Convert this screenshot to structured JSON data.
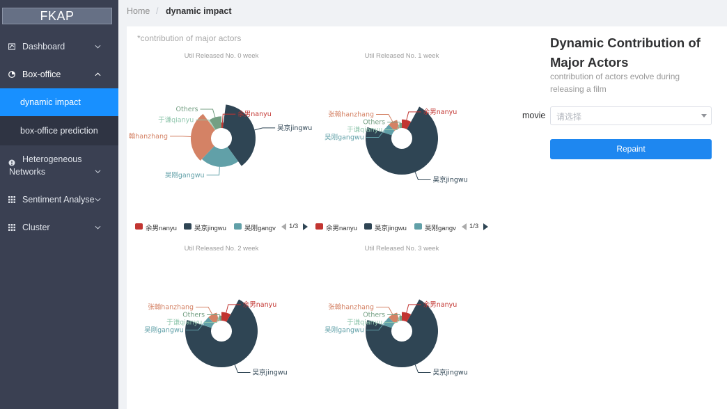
{
  "app": {
    "logo": "FKAP"
  },
  "sidebar": {
    "items": [
      {
        "label": "Dashboard",
        "icon": "dashboard-icon"
      },
      {
        "label": "Box-office",
        "icon": "pie-icon"
      },
      {
        "label": "Heterogeneous Networks",
        "label_line1": "Heterogeneous",
        "label_line2": "Networks",
        "icon": "network-icon"
      },
      {
        "label": "Sentiment Analyse",
        "icon": "grid-icon"
      },
      {
        "label": "Cluster",
        "icon": "grid-icon"
      }
    ],
    "submenu": [
      {
        "label": "dynamic impact",
        "active": true
      },
      {
        "label": "box-office prediction",
        "active": false
      }
    ]
  },
  "breadcrumb": {
    "home": "Home",
    "sep": "/",
    "current": "dynamic impact"
  },
  "main": {
    "sup_title": "*contribution of major actors"
  },
  "right_panel": {
    "title": "Dynamic Contribution of Major Actors",
    "subtitle": " contribution of actors evolve during releasing a film",
    "movie_label": "movie",
    "select_placeholder": "请选择",
    "button_label": "Repaint"
  },
  "colors": {
    "nanyu": "#c23531",
    "jingwu": "#2f4554",
    "gangwu": "#61a0a8",
    "hanzhang": "#d48265",
    "qianyu": "#91c7ae",
    "others": "#749f83",
    "accent": "#1890ff"
  },
  "chart_data": [
    {
      "type": "pie",
      "variant": "rose",
      "title": "Util Released No. 0 week",
      "slices": [
        {
          "name": "余男nanyu",
          "value": 4,
          "color": "#c23531"
        },
        {
          "name": "吴京jingwu",
          "value": 74,
          "color": "#2f4554"
        },
        {
          "name": "吴刚gangwu",
          "value": 43,
          "color": "#61a0a8"
        },
        {
          "name": "翰hanzhang",
          "value": 54,
          "color": "#d48265"
        },
        {
          "name": "于谦qianyu",
          "value": 2,
          "color": "#91c7ae"
        },
        {
          "name": "Others",
          "value": 18,
          "color": "#749f83"
        }
      ],
      "legend": {
        "items": [
          "余男nanyu",
          "吴京jingwu",
          "吴刚gangv"
        ],
        "page": "1/3"
      }
    },
    {
      "type": "pie",
      "variant": "rose",
      "title": "Util Released No. 1 week",
      "slices": [
        {
          "name": "余男nanyu",
          "value": 12,
          "color": "#c23531"
        },
        {
          "name": "吴京jingwu",
          "value": 108,
          "color": "#2f4554"
        },
        {
          "name": "吴刚gangwu",
          "value": 12,
          "color": "#61a0a8"
        },
        {
          "name": "张翰hanzhang",
          "value": 12,
          "color": "#d48265"
        },
        {
          "name": "于谦qianyu",
          "value": 2,
          "color": "#91c7ae"
        },
        {
          "name": "Others",
          "value": 4,
          "color": "#749f83"
        }
      ],
      "legend": {
        "items": [
          "余男nanyu",
          "吴京jingwu",
          "吴刚gangv"
        ],
        "page": "1/3"
      }
    },
    {
      "type": "pie",
      "variant": "rose",
      "title": "Util Released No. 2 week",
      "slices": [
        {
          "name": "余男nanyu",
          "value": 12,
          "color": "#c23531"
        },
        {
          "name": "吴京jingwu",
          "value": 108,
          "color": "#2f4554"
        },
        {
          "name": "吴刚gangwu",
          "value": 12,
          "color": "#61a0a8"
        },
        {
          "name": "张翰hanzhang",
          "value": 12,
          "color": "#d48265"
        },
        {
          "name": "于谦qianyu",
          "value": 2,
          "color": "#91c7ae"
        },
        {
          "name": "Others",
          "value": 4,
          "color": "#749f83"
        }
      ]
    },
    {
      "type": "pie",
      "variant": "rose",
      "title": "Util Released No. 3 week",
      "slices": [
        {
          "name": "余男nanyu",
          "value": 12,
          "color": "#c23531"
        },
        {
          "name": "吴京jingwu",
          "value": 108,
          "color": "#2f4554"
        },
        {
          "name": "吴刚gangwu",
          "value": 12,
          "color": "#61a0a8"
        },
        {
          "name": "张翰hanzhang",
          "value": 12,
          "color": "#d48265"
        },
        {
          "name": "于谦qianyu",
          "value": 2,
          "color": "#91c7ae"
        },
        {
          "name": "Others",
          "value": 4,
          "color": "#749f83"
        }
      ]
    }
  ]
}
